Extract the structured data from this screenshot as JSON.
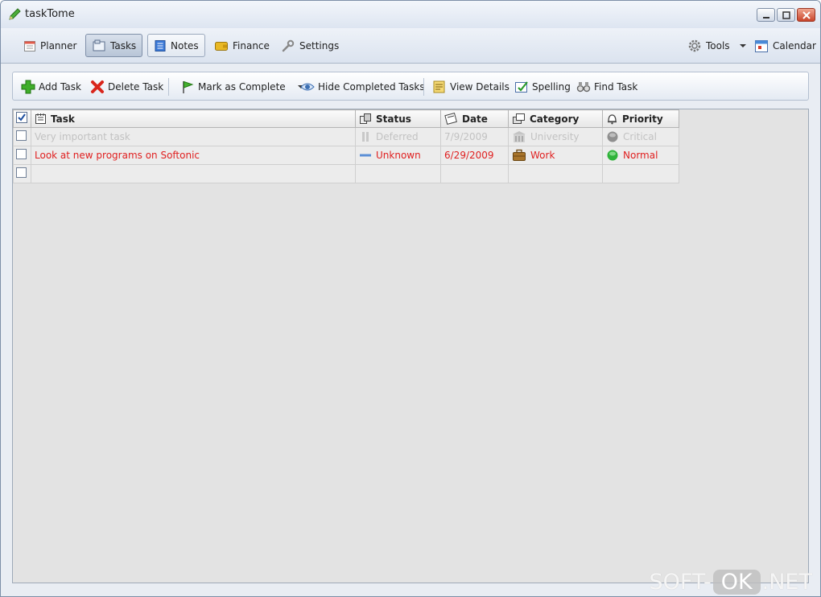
{
  "window": {
    "title": "taskTome"
  },
  "nav": {
    "planner": "Planner",
    "tasks": "Tasks",
    "notes": "Notes",
    "finance": "Finance",
    "settings": "Settings",
    "tools": "Tools",
    "calendar": "Calendar"
  },
  "toolbar": {
    "add_task": "Add Task",
    "delete_task": "Delete Task",
    "mark_complete": "Mark as Complete",
    "hide_completed": "Hide Completed Tasks",
    "view_details": "View Details",
    "spelling": "Spelling",
    "find_task": "Find Task"
  },
  "grid": {
    "columns": {
      "task": "Task",
      "status": "Status",
      "date": "Date",
      "category": "Category",
      "priority": "Priority"
    },
    "rows": [
      {
        "task": "Very important task",
        "status": "Deferred",
        "date": "7/9/2009",
        "category": "University",
        "priority": "Critical",
        "checked": false,
        "style": "faded"
      },
      {
        "task": "Look at new programs on Softonic",
        "status": "Unknown",
        "date": "6/29/2009",
        "category": "Work",
        "priority": "Normal",
        "checked": false,
        "style": "red"
      }
    ]
  },
  "watermark": {
    "left": "SOFT-",
    "mid": "OK",
    "right": ".NET"
  },
  "colors": {
    "highlight_text": "#e02020",
    "faded_text": "#c2c2c2",
    "grid_background": "#e3e3e3"
  }
}
